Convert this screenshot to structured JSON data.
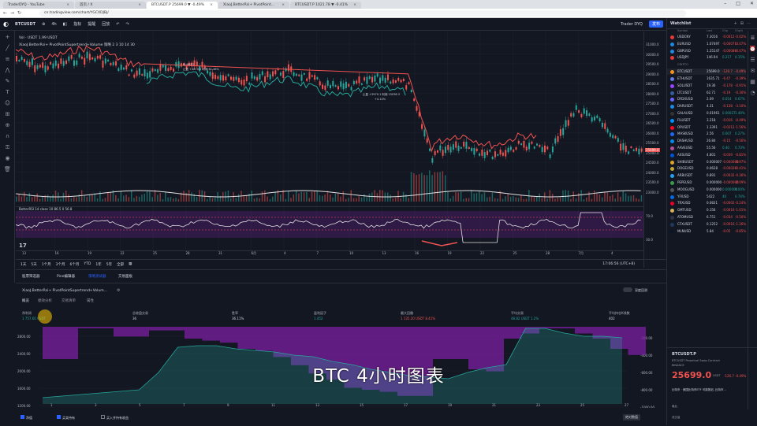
{
  "browser": {
    "tabs": [
      {
        "label": "TraderDYQ - YouTube",
        "active": false
      },
      {
        "label": "首页 / X",
        "active": false
      },
      {
        "label": "BTCUSDT.P 25699.0 ▼ -0.49%",
        "active": true
      },
      {
        "label": "XiaoJ.BetterRsi+ PivotPoint...",
        "active": false
      },
      {
        "label": "BTCUSDT.P 1021.78 ▼ -0.41%",
        "active": false
      }
    ],
    "url": "cn.tradingview.com/chart/YGCXDJBj/"
  },
  "toolbar": {
    "symbol": "BTCUSDT",
    "interval": "4h",
    "items": [
      "指标",
      "提醒",
      "回放"
    ],
    "publish_label": "发布",
    "account": "Trader DYQ"
  },
  "chart": {
    "info_line": "Vol · USDT  1.99 USDT",
    "indicator_line": "XiaoJ.BetterRsi+ PivotPointSupertrend+Volume 策略 2  3  10  14  30",
    "annotations": [
      {
        "text": "价.HKD7"
      },
      {
        "text": "止盈 +4870.0 利润 61.46%"
      },
      {
        "text": "止盈 +3970.1 利润 15036.3"
      },
      {
        "text": "+4.14%"
      }
    ],
    "rsi_label": "BetterRSI  14  close  10  86.5  0  56.8",
    "price_ticks": [
      "31000.0",
      "30000.0",
      "29500.0",
      "29000.0",
      "28500.0",
      "28000.0",
      "27500.0",
      "27000.0",
      "26500.0",
      "26000.0",
      "25500.0",
      "25000.0",
      "24500.0",
      "24000.0",
      "23500.0",
      "23000.0"
    ],
    "current_price": "25699.0",
    "time_ticks": [
      "13",
      "16",
      "19",
      "22",
      "25",
      "28",
      "31",
      "6月",
      "4",
      "7",
      "10",
      "13",
      "16",
      "19",
      "22",
      "25",
      "28",
      "7月",
      "4"
    ],
    "range_buttons": [
      "1天",
      "5天",
      "1个月",
      "3个月",
      "6个月",
      "YTD",
      "1年",
      "5年",
      "全部"
    ],
    "timestamp": "17:06:56 (UTC+8)"
  },
  "panel": {
    "tabs": [
      "股票筛选器",
      "Pine编辑器",
      "策略测试器",
      "交易面板"
    ],
    "active_tab": 2,
    "strategy_name": "XiaoJ.BetterRsi+ PivotPointSupertrend+Volum...",
    "subtabs": [
      "概览",
      "绩效分析",
      "交易清单",
      "属性"
    ],
    "stats": [
      {
        "label": "净利润",
        "value": "1 757.60 USDT",
        "tone": "g"
      },
      {
        "label": "总收盘交易",
        "value": "36",
        "tone": "w"
      },
      {
        "label": "胜率",
        "value": "36.11%",
        "tone": "w"
      },
      {
        "label": "盈利因子",
        "value": "1.452",
        "tone": "g"
      },
      {
        "label": "最大回撤",
        "value": "1 135.20 USDT  8.41%",
        "tone": "red"
      },
      {
        "label": "平均交易",
        "value": "48.82 USDT  1.2%",
        "tone": "g"
      },
      {
        "label": "平均持仓K线数",
        "value": "402",
        "tone": "w"
      }
    ],
    "equity_axis": [
      "2800.00",
      "2400.00",
      "2000.00",
      "1600.00",
      "1200.00"
    ],
    "dd_axis": [
      "-200.00",
      "-400.00",
      "-600.00",
      "-800.00",
      "-1000.00"
    ],
    "x_axis": [
      "1",
      "3",
      "5",
      "7",
      "9",
      "11",
      "13",
      "15",
      "17",
      "19",
      "21",
      "23",
      "25",
      "27"
    ],
    "footer": {
      "cb1": "净值",
      "cb2": "买卖持有",
      "cb3": "买入并持有收益",
      "btn": "绝对数值"
    }
  },
  "watchlist": {
    "title": "Watchlist",
    "rows": [
      {
        "sym": "USDCNY",
        "last": "7.3016",
        "chg": "-0.0012",
        "pct": "-0.02%",
        "tone": "r",
        "color": "#e53935"
      },
      {
        "sym": "EURUSD",
        "last": "1.07497",
        "chg": "-0.00071",
        "pct": "-0.07%",
        "tone": "r",
        "color": "#1e88e5"
      },
      {
        "sym": "GBPUSD",
        "last": "1.25147",
        "chg": "-0.00086",
        "pct": "-0.07%",
        "tone": "r",
        "color": "#1e88e5"
      },
      {
        "sym": "USDJPY",
        "last": "146.94",
        "chg": "0.217",
        "pct": "0.15%",
        "tone": "g",
        "color": "#e53935"
      },
      {
        "sym": "BTCUSDT",
        "last": "25699.0",
        "chg": "-126.7",
        "pct": "-0.49%",
        "tone": "r",
        "color": "#f7931a"
      },
      {
        "sym": "ETHUSDT",
        "last": "1635.71",
        "chg": "-6.47",
        "pct": "-0.39%",
        "tone": "r",
        "color": "#627eea"
      },
      {
        "sym": "SOLUSDT",
        "last": "19.36",
        "chg": "-0.178",
        "pct": "-0.91%",
        "tone": "r",
        "color": "#9945ff"
      },
      {
        "sym": "LTCUSDT",
        "last": "62.71",
        "chg": "-0.19",
        "pct": "-0.30%",
        "tone": "r",
        "color": "#345d9d"
      },
      {
        "sym": "DYDXUSD",
        "last": "2.09",
        "chg": "0.014",
        "pct": "0.67%",
        "tone": "g",
        "color": "#6966ff"
      },
      {
        "sym": "DARUSDT",
        "last": "4.31",
        "chg": "-0.138",
        "pct": "-3.10%",
        "tone": "r",
        "color": "#1e88e5"
      },
      {
        "sym": "GALAUSD",
        "last": "0.01961",
        "chg": "0.00027",
        "pct": "1.40%",
        "tone": "g",
        "color": "#333"
      },
      {
        "sym": "FILUSDT",
        "last": "3.218",
        "chg": "-0.016",
        "pct": "-0.49%",
        "tone": "r",
        "color": "#0090ff"
      },
      {
        "sym": "OPUSDT",
        "last": "1.3391",
        "chg": "-0.0212",
        "pct": "-1.56%",
        "tone": "r",
        "color": "#ff0420"
      },
      {
        "sym": "MASKUSD",
        "last": "2.56",
        "chg": "0.007",
        "pct": "0.27%",
        "tone": "g",
        "color": "#1c68f3"
      },
      {
        "sym": "DASHUSD",
        "last": "26.84",
        "chg": "-0.15",
        "pct": "-0.56%",
        "tone": "r",
        "color": "#008ce7"
      },
      {
        "sym": "AAVEUSD",
        "last": "55.56",
        "chg": "0.40",
        "pct": "0.73%",
        "tone": "g",
        "color": "#b6509e"
      },
      {
        "sym": "AXSUSD",
        "last": "4.801",
        "chg": "-0.039",
        "pct": "-0.81%",
        "tone": "r",
        "color": "#0055d5"
      },
      {
        "sym": "SHIBUSDT",
        "last": "0.000007",
        "chg": "-0.000000",
        "pct": "-0.97%",
        "tone": "r",
        "color": "#e0a22b"
      },
      {
        "sym": "DOGEUSD",
        "last": "0.0628",
        "chg": "-0.00026",
        "pct": "-0.41%",
        "tone": "r",
        "color": "#c2a633"
      },
      {
        "sym": "ARBUSDT",
        "last": "0.891",
        "chg": "-0.0032",
        "pct": "-0.36%",
        "tone": "r",
        "color": "#28a0f0"
      },
      {
        "sym": "PEPEUSD",
        "last": "0.000000",
        "chg": "-0.000000",
        "pct": "-2.09%",
        "tone": "r",
        "color": "#3d9a4b"
      },
      {
        "sym": "MOOGUSD",
        "last": "0.000000",
        "chg": "0.000000",
        "pct": "0.00%",
        "tone": "g",
        "color": "#555"
      },
      {
        "sym": "YFIUSD",
        "last": "5422",
        "chg": "40",
        "pct": "0.74%",
        "tone": "g",
        "color": "#006ae3"
      },
      {
        "sym": "TRXUSD",
        "last": "0.0831",
        "chg": "-0.0002",
        "pct": "-0.24%",
        "tone": "r",
        "color": "#eb0029"
      },
      {
        "sym": "GMTUSD",
        "last": "0.156",
        "chg": "-0.0016",
        "pct": "-1.01%",
        "tone": "r",
        "color": "#d7b45c"
      },
      {
        "sym": "ATOMUSD",
        "last": "6.751",
        "chg": "-0.034",
        "pct": "-0.50%",
        "tone": "r",
        "color": "#2e3148"
      },
      {
        "sym": "CFXUSDT",
        "last": "0.1252",
        "chg": "-0.0016",
        "pct": "-1.26%",
        "tone": "r",
        "color": "#1e3a5f"
      },
      {
        "sym": "MLNUSD",
        "last": "5.84",
        "chg": "-0.05",
        "pct": "-0.85%",
        "tone": "r",
        "color": "#0b1529"
      }
    ],
    "detail": {
      "symbol": "BTCUSDT.P",
      "desc": "BTCUSDT Perpetual Swap Contract",
      "exchange": "BINANCE",
      "price": "25699.0",
      "currency": "USDT",
      "change": "-126.7  -0.49%",
      "news_hint": "比特币 · 美国比特币ETF 可能推迟, 比特币...",
      "row1": "最后",
      "row2": "成交量"
    }
  },
  "subtitle": "BTC 4小时图表"
}
